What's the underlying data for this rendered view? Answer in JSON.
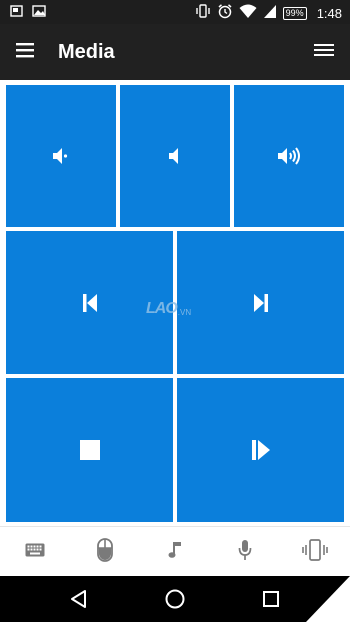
{
  "status_bar": {
    "time": "1:48",
    "battery_percent": "99%",
    "icons": [
      "notification-icon",
      "image-icon",
      "vibrate-icon",
      "alarm-icon",
      "wifi-icon",
      "cell-signal-icon",
      "battery-icon"
    ]
  },
  "app_bar": {
    "title": "Media",
    "menu_icon": "hamburger-icon",
    "options_icon": "list-menu-icon"
  },
  "tiles": [
    {
      "action": "Volume mute",
      "icon": "volume-mute-icon"
    },
    {
      "action": "Volume down",
      "icon": "volume-down-icon"
    },
    {
      "action": "Volume up",
      "icon": "volume-up-icon"
    },
    {
      "action": "Previous track",
      "icon": "previous-track-icon"
    },
    {
      "action": "Next track",
      "icon": "next-track-icon"
    },
    {
      "action": "Stop",
      "icon": "stop-icon"
    },
    {
      "action": "Play/Pause",
      "icon": "play-pause-icon"
    }
  ],
  "watermark": {
    "main": "LAO",
    "sub": ".VN"
  },
  "bottom_tabs": [
    {
      "name": "Keyboard",
      "icon": "keyboard-icon"
    },
    {
      "name": "Mouse",
      "icon": "mouse-icon"
    },
    {
      "name": "Media",
      "icon": "music-note-icon"
    },
    {
      "name": "Voice",
      "icon": "microphone-icon"
    },
    {
      "name": "Device",
      "icon": "phone-vibrate-icon"
    }
  ],
  "nav_bar": {
    "buttons": [
      "back-icon",
      "home-icon",
      "recents-icon"
    ]
  },
  "colors": {
    "tile_blue": "#0b7fdb",
    "app_bar": "#212121",
    "status_bar": "#1e1e1e",
    "tab_icon": "#7a7a7a",
    "nav_bar": "#000000"
  }
}
